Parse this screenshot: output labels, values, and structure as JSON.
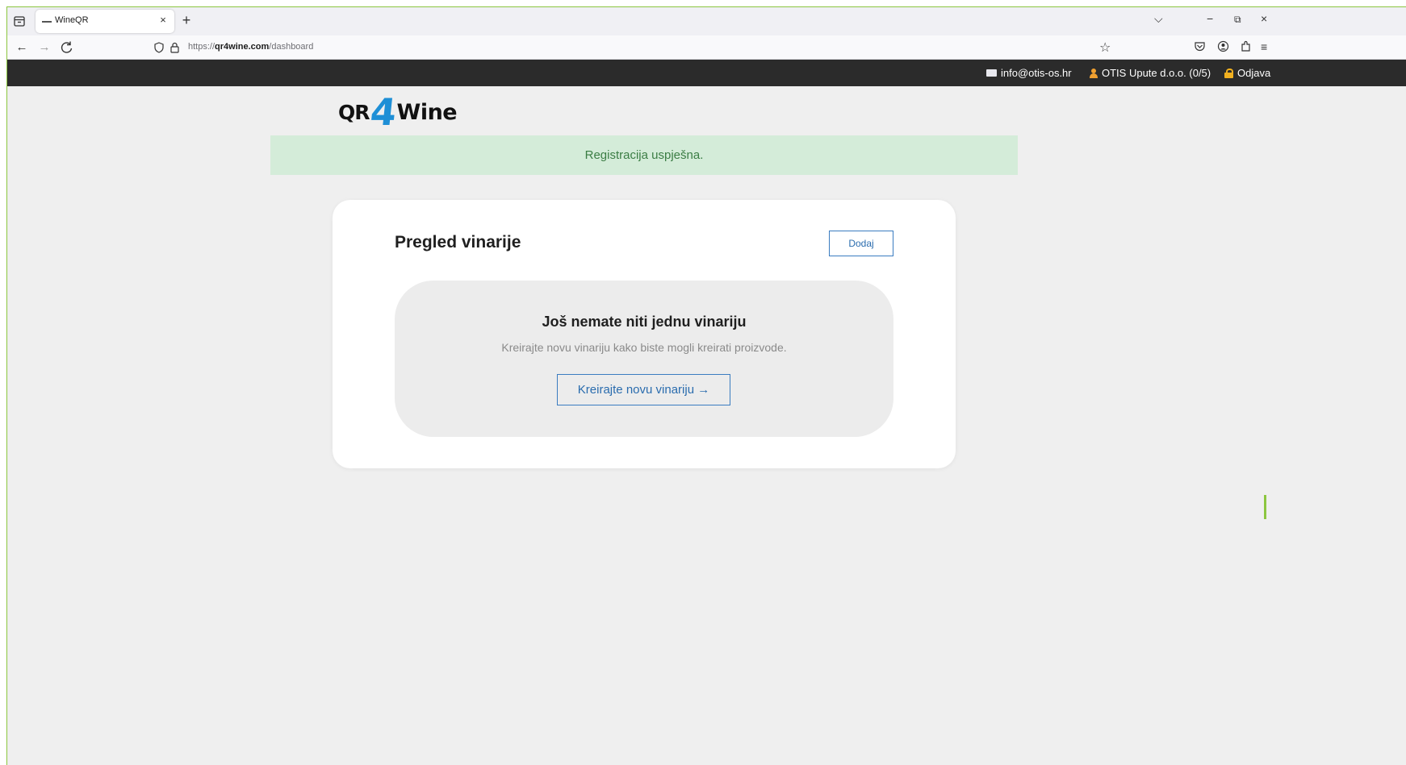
{
  "browser": {
    "tab_title": "WineQR",
    "tab_close": "×",
    "new_tab": "+",
    "url_prefix": "https://",
    "url_domain": "qr4wine.com",
    "url_path": "/dashboard",
    "window_controls": {
      "list": "⌵",
      "minimize": "−",
      "restore": "⧉",
      "close": "×"
    },
    "nav": {
      "back": "←",
      "forward": "→",
      "reload": "C"
    }
  },
  "topbar": {
    "email": "info@otis-os.hr",
    "company": "OTIS Upute d.o.o. (0/5)",
    "logout": "Odjava"
  },
  "logo": {
    "left": "QR",
    "number": "4",
    "right": "Wine",
    "accent_color": "#1e8fd6"
  },
  "alert": {
    "text": "Registracija uspješna.",
    "color": "#d4ecd9"
  },
  "card": {
    "title": "Pregled vinarije",
    "add_button": "Dodaj",
    "empty_state": {
      "title": "Još nemate niti jednu vinariju",
      "description": "Kreirajte novu vinariju kako biste mogli kreirati proizvode.",
      "cta": "Kreirajte novu vinariju →"
    }
  }
}
